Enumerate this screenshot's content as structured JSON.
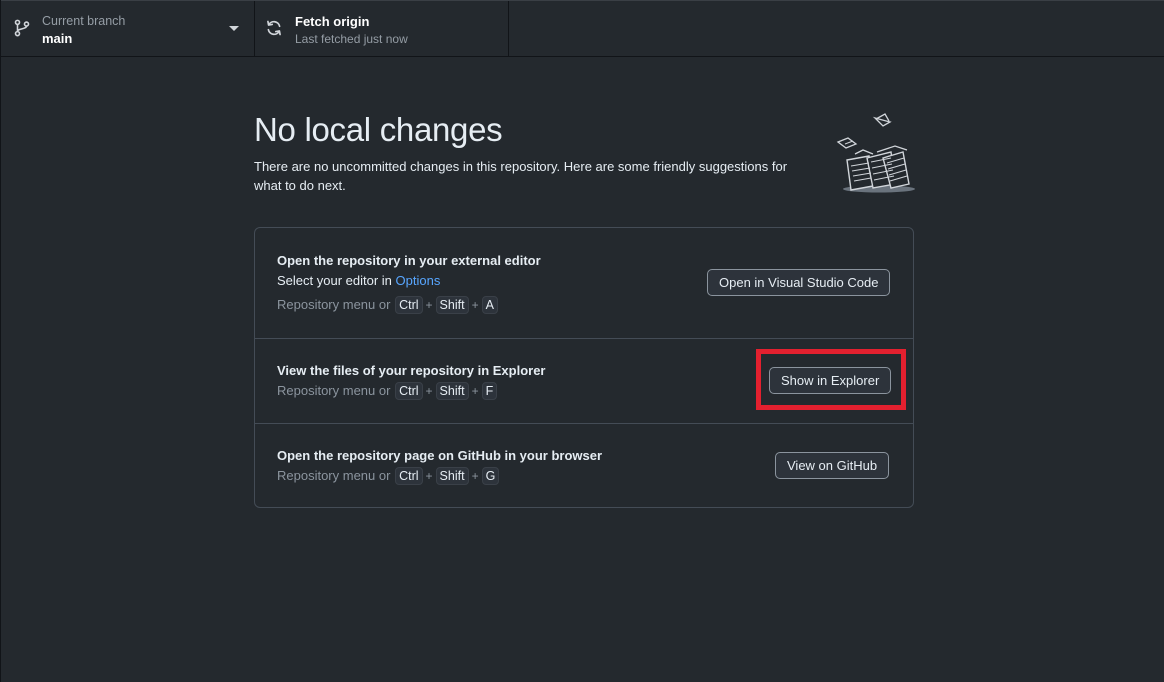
{
  "toolbar": {
    "branch": {
      "caption": "Current branch",
      "value": "main",
      "icon": "git-branch-icon"
    },
    "fetch": {
      "title": "Fetch origin",
      "subtitle": "Last fetched just now",
      "icon": "sync-icon"
    }
  },
  "main": {
    "title": "No local changes",
    "description": "There are no uncommitted changes in this repository. Here are some friendly suggestions for what to do next.",
    "suggestions": [
      {
        "title": "Open the repository in your external editor",
        "subtitle_prefix": "Select your editor in ",
        "subtitle_link": "Options",
        "shortcut_prefix": "Repository menu or",
        "keys": [
          "Ctrl",
          "Shift",
          "A"
        ],
        "button": "Open in Visual Studio Code"
      },
      {
        "title": "View the files of your repository in Explorer",
        "shortcut_prefix": "Repository menu or",
        "keys": [
          "Ctrl",
          "Shift",
          "F"
        ],
        "button": "Show in Explorer"
      },
      {
        "title": "Open the repository page on GitHub in your browser",
        "shortcut_prefix": "Repository menu or",
        "keys": [
          "Ctrl",
          "Shift",
          "G"
        ],
        "button": "View on GitHub"
      }
    ],
    "key_separator": "+"
  },
  "colors": {
    "background": "#24292e",
    "link": "#58a6ff",
    "highlight": "#e3202f",
    "border": "#444c56"
  }
}
